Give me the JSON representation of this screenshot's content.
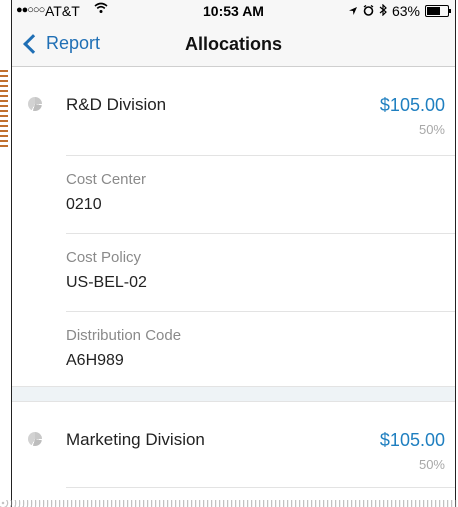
{
  "status_bar": {
    "signal": "●●○○○",
    "carrier": "AT&T",
    "time": "10:53 AM",
    "battery_text": "63%",
    "battery_level": 0.63
  },
  "navbar": {
    "back_label": "Report",
    "title": "Allocations"
  },
  "allocations": [
    {
      "division": "R&D Division",
      "amount": "$105.00",
      "percent": "50%",
      "fields": [
        {
          "label": "Cost Center",
          "value": "0210"
        },
        {
          "label": "Cost Policy",
          "value": "US-BEL-02"
        },
        {
          "label": "Distribution Code",
          "value": "A6H989"
        }
      ]
    },
    {
      "division": "Marketing Division",
      "amount": "$105.00",
      "percent": "50%"
    }
  ],
  "colors": {
    "accent": "#1f7fc0",
    "back": "#1f6fb5",
    "label": "#8a8a8a"
  }
}
